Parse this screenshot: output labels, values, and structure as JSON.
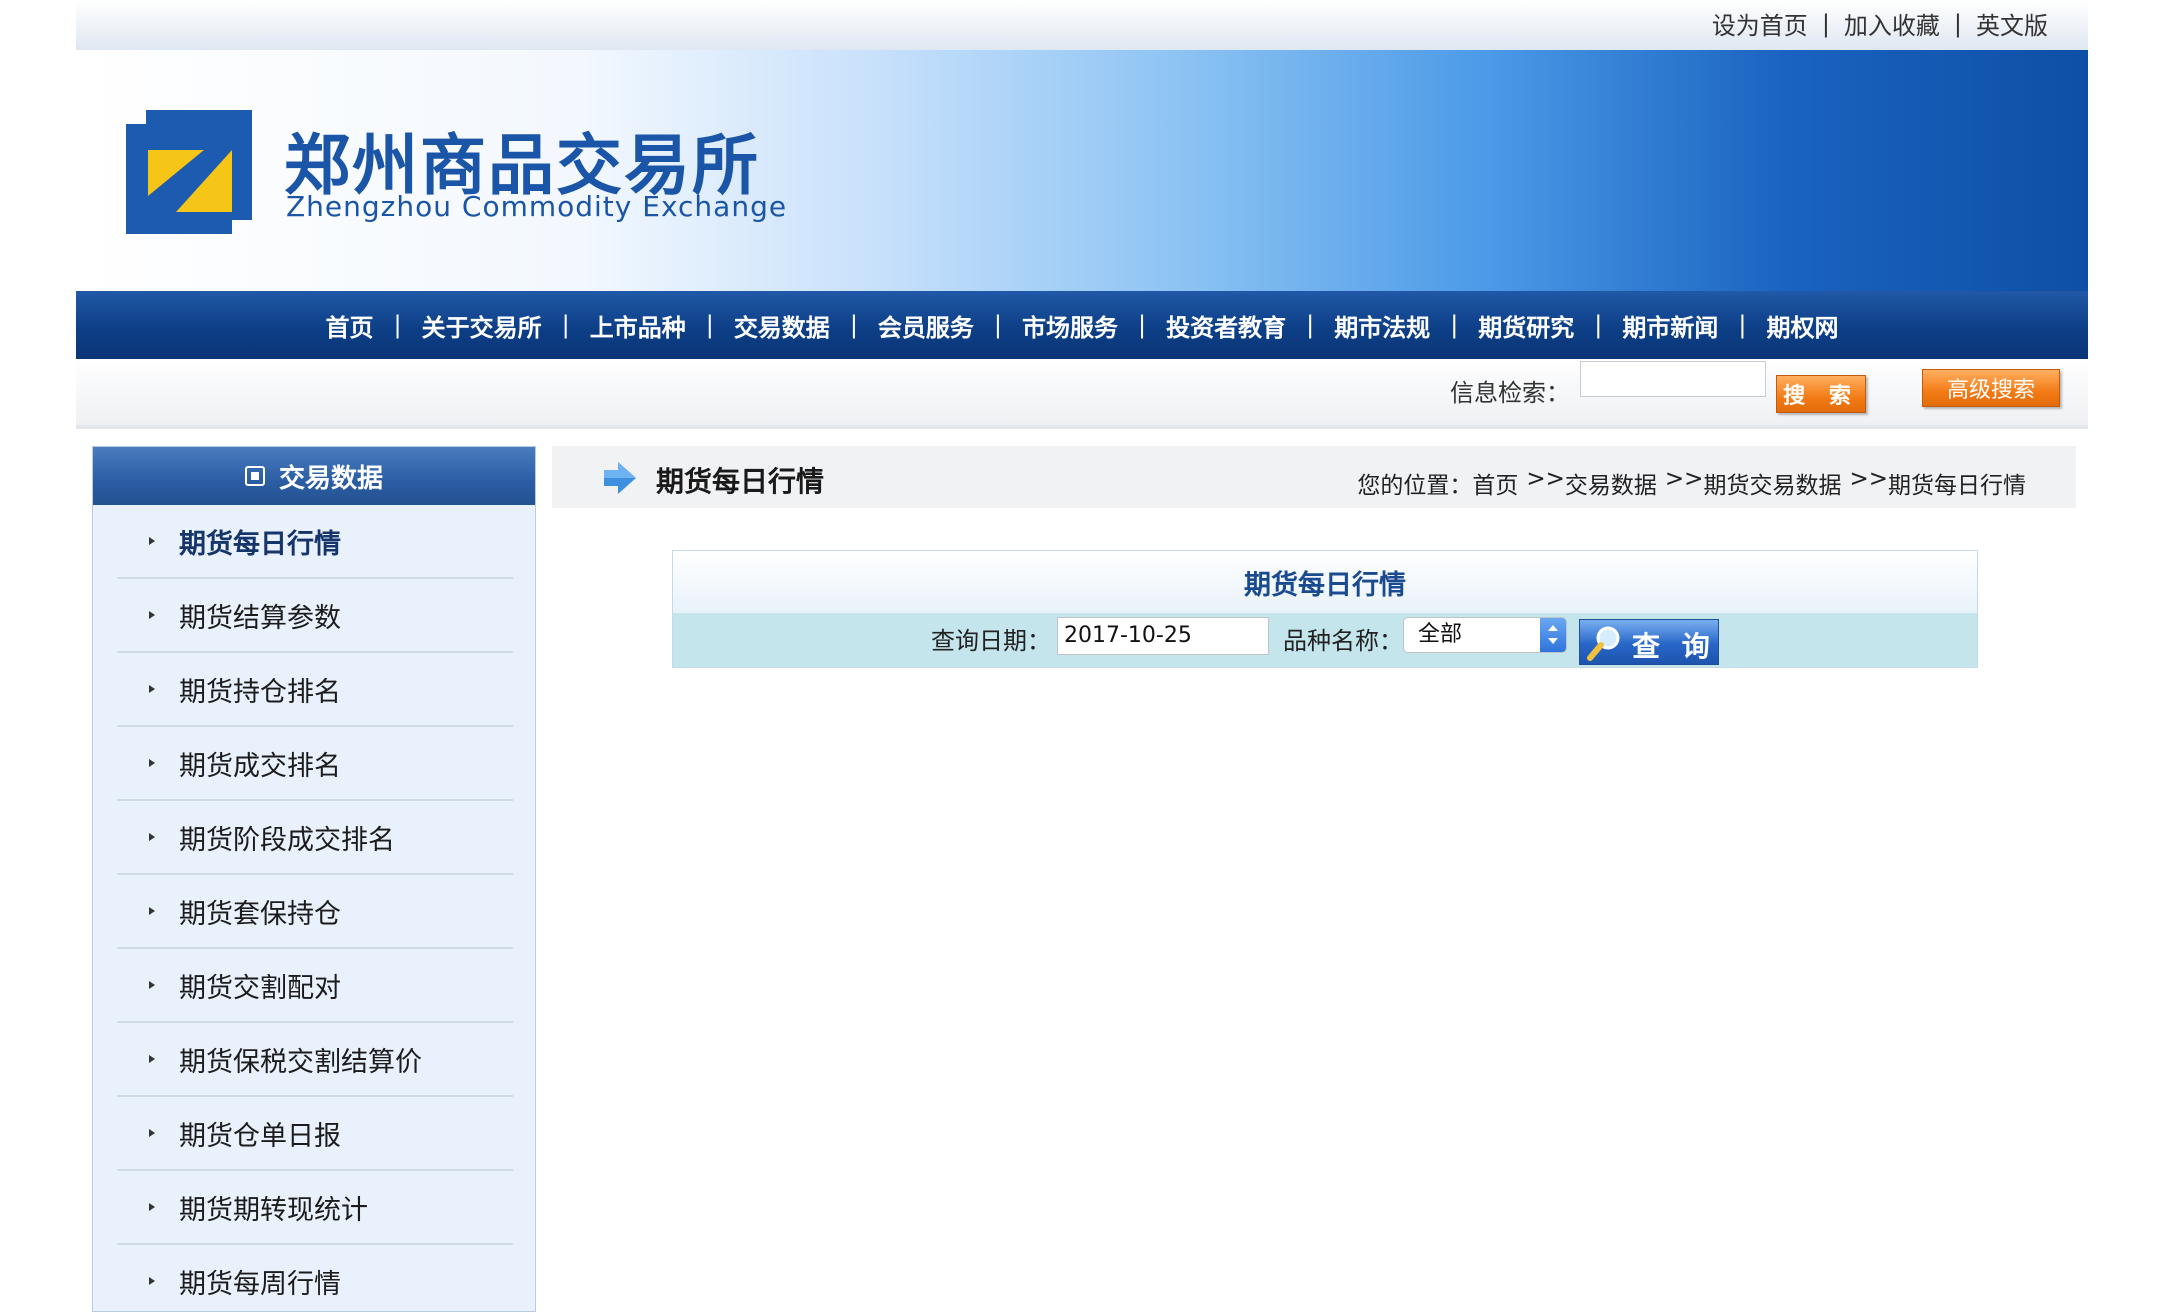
{
  "top_links": {
    "set_homepage": "设为首页",
    "add_favorite": "加入收藏",
    "english": "英文版"
  },
  "brand": {
    "name_cn": "郑州商品交易所",
    "name_en": "Zhengzhou Commodity Exchange"
  },
  "nav": [
    "首页",
    "关于交易所",
    "上市品种",
    "交易数据",
    "会员服务",
    "市场服务",
    "投资者教育",
    "期市法规",
    "期货研究",
    "期市新闻",
    "期权网"
  ],
  "search": {
    "label": "信息检索：",
    "search_button": "搜 索",
    "advanced_button": "高级搜索"
  },
  "sidebar": {
    "title": "交易数据",
    "items": [
      {
        "label": "期货每日行情"
      },
      {
        "label": "期货结算参数"
      },
      {
        "label": "期货持仓排名"
      },
      {
        "label": "期货成交排名"
      },
      {
        "label": "期货阶段成交排名"
      },
      {
        "label": "期货套保持仓"
      },
      {
        "label": "期货交割配对"
      },
      {
        "label": "期货保税交割结算价"
      },
      {
        "label": "期货仓单日报"
      },
      {
        "label": "期货期转现统计"
      },
      {
        "label": "期货每周行情"
      }
    ]
  },
  "content": {
    "title": "期货每日行情",
    "breadcrumb": {
      "prefix": "您的位置：",
      "home": "首页",
      "sep": ">>",
      "level1": "交易数据",
      "level2": "期货交易数据",
      "level3": "期货每日行情"
    }
  },
  "query": {
    "panel_title": "期货每日行情",
    "date_label": "查询日期：",
    "date_value": "2017-10-25",
    "kind_label": "品种名称：",
    "kind_value": "全部",
    "button": "查 询"
  }
}
